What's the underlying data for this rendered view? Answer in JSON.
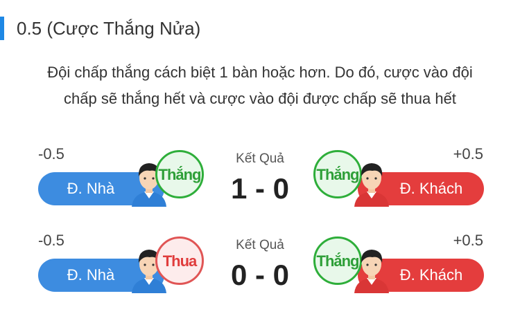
{
  "title": "0.5 (Cược Thắng Nửa)",
  "description_line1": "Đội chấp thắng cách biệt 1 bàn hoặc hơn. Do đó, cược vào đội",
  "description_line2": "chấp sẽ thắng hết và cược vào đội được chấp sẽ thua hết",
  "colors": {
    "accent": "#1e88e5",
    "home": "#3d8ce0",
    "away": "#e43d3d",
    "win": "#2eae3a",
    "lose": "#e05555"
  },
  "rows": [
    {
      "home_odds": "-0.5",
      "away_odds": "+0.5",
      "home_label": "Đ. Nhà",
      "away_label": "Đ. Khách",
      "result_label": "Kết Quả",
      "score": "1 - 0",
      "home_badge": "Thắng",
      "away_badge": "Thắng"
    },
    {
      "home_odds": "-0.5",
      "away_odds": "+0.5",
      "home_label": "Đ. Nhà",
      "away_label": "Đ. Khách",
      "result_label": "Kết Quả",
      "score": "0 - 0",
      "home_badge": "Thua",
      "away_badge": "Thắng"
    }
  ]
}
